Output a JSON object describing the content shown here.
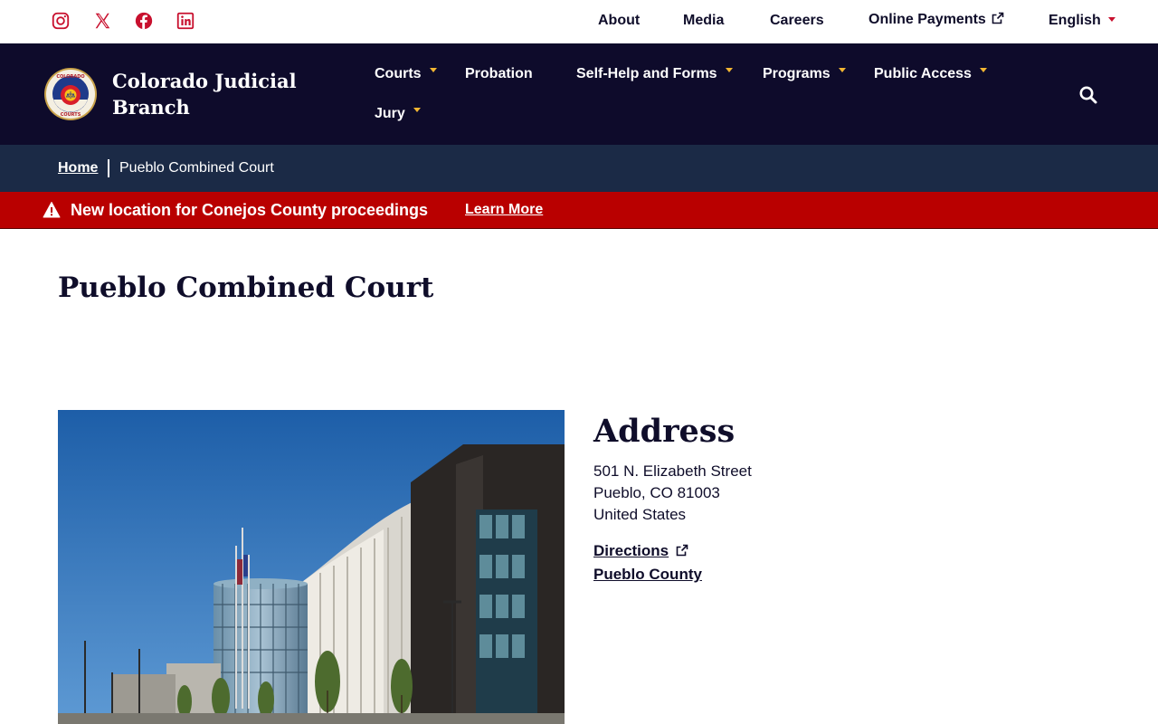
{
  "utility": {
    "social": [
      {
        "name": "instagram-icon"
      },
      {
        "name": "x-twitter-icon"
      },
      {
        "name": "facebook-icon"
      },
      {
        "name": "linkedin-icon"
      }
    ],
    "about": "About",
    "media": "Media",
    "careers": "Careers",
    "online_payments": "Online Payments",
    "language": "English"
  },
  "brand": {
    "line1": "Colorado Judicial",
    "line2": "Branch",
    "seal_text_top": "COLORADO",
    "seal_text_bottom": "COURTS"
  },
  "nav": {
    "courts": "Courts",
    "probation": "Probation",
    "self_help": "Self-Help and Forms",
    "programs": "Programs",
    "public_access": "Public Access",
    "jury": "Jury"
  },
  "breadcrumb": {
    "home": "Home",
    "current": "Pueblo Combined Court"
  },
  "alert": {
    "message": "New location for Conejos County proceedings",
    "link": "Learn More"
  },
  "page": {
    "title": "Pueblo Combined Court"
  },
  "address": {
    "heading": "Address",
    "street": "501 N. Elizabeth Street",
    "city_line": "Pueblo, CO 81003",
    "country": "United States",
    "directions": "Directions",
    "county": "Pueblo County"
  },
  "colors": {
    "navy": "#0e0b2b",
    "breadcrumb_bg": "#1b2a46",
    "alert_red": "#b90000",
    "accent_gold": "#f2b632",
    "social_red": "#c8102e"
  }
}
